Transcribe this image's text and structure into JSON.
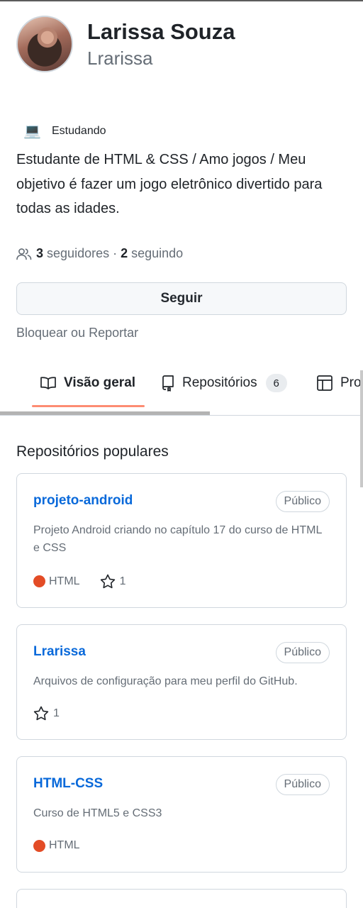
{
  "profile": {
    "full_name": "Larissa Souza",
    "username": "Lrarissa",
    "status_emoji": "💻",
    "status_text": "Estudando",
    "bio": "Estudante de HTML & CSS / Amo jogos / Meu objetivo é fazer um jogo eletrônico divertido para todas as idades.",
    "followers_count": "3",
    "followers_label": "seguidores",
    "separator": "·",
    "following_count": "2",
    "following_label": "seguindo",
    "follow_button": "Seguir",
    "block_link": "Bloquear ou Reportar"
  },
  "tabs": {
    "overview": "Visão geral",
    "repositories": "Repositórios",
    "repositories_count": "6",
    "projects": "Projetos"
  },
  "popular": {
    "title": "Repositórios populares",
    "repos": [
      {
        "name": "projeto-android",
        "visibility": "Público",
        "description": "Projeto Android criando no capítulo 17 do curso de HTML e CSS",
        "language": "HTML",
        "stars": "1"
      },
      {
        "name": "Lrarissa",
        "visibility": "Público",
        "description": "Arquivos de configuração para meu perfil do GitHub.",
        "stars": "1"
      },
      {
        "name": "HTML-CSS",
        "visibility": "Público",
        "description": "Curso de HTML5 e CSS3",
        "language": "HTML"
      }
    ]
  },
  "colors": {
    "link_blue": "#0969da",
    "tab_underline": "#fd8c73",
    "html_language": "#e34c26"
  }
}
